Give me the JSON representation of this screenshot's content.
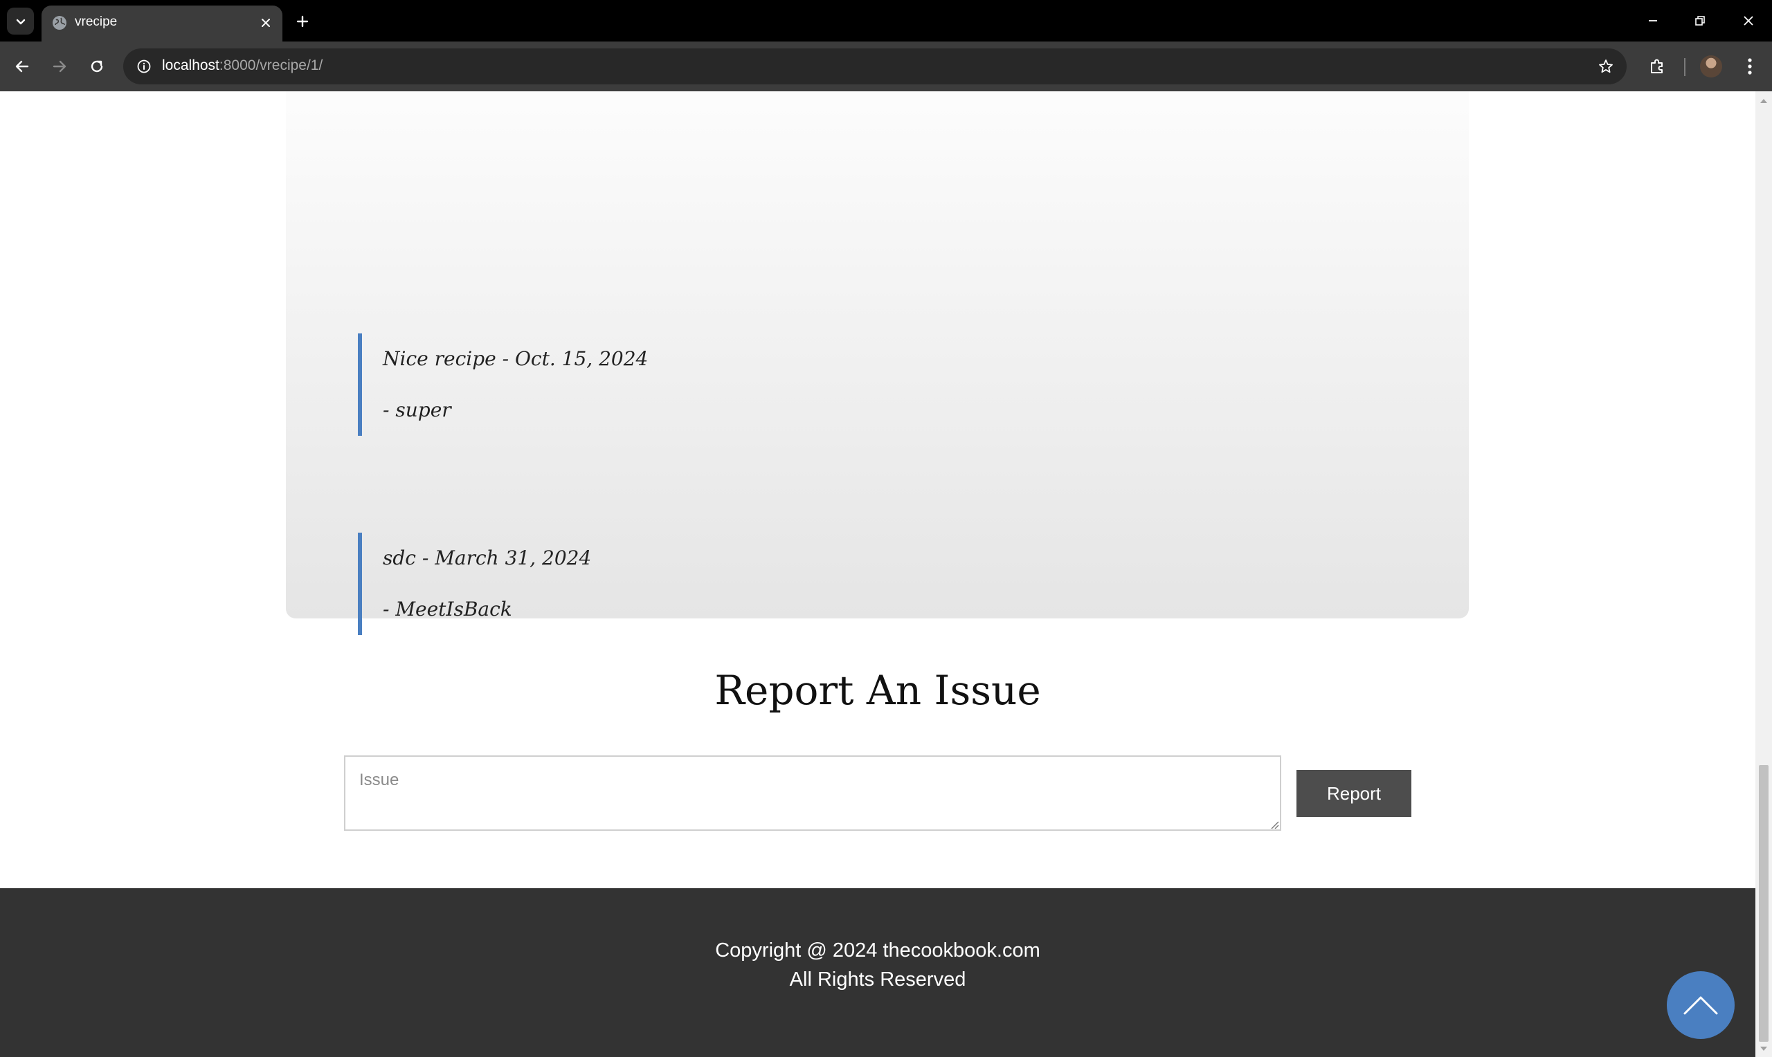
{
  "browser": {
    "tab_title": "vrecipe",
    "url_host": "localhost",
    "url_rest": ":8000/vrecipe/1/"
  },
  "comments": [
    {
      "text": "Nice recipe - Oct. 15, 2024",
      "author": "- super"
    },
    {
      "text": "sdc - March 31, 2024",
      "author": "- MeetIsBack"
    }
  ],
  "report": {
    "heading": "Report An Issue",
    "placeholder": "Issue",
    "button_label": "Report"
  },
  "footer": {
    "line1": "Copyright @ 2024 thecookbook.com",
    "line2": "All Rights Reserved"
  },
  "colors": {
    "accent": "#4a7fc1",
    "footer_bg": "#333333",
    "button_bg": "#4d4d4d"
  }
}
